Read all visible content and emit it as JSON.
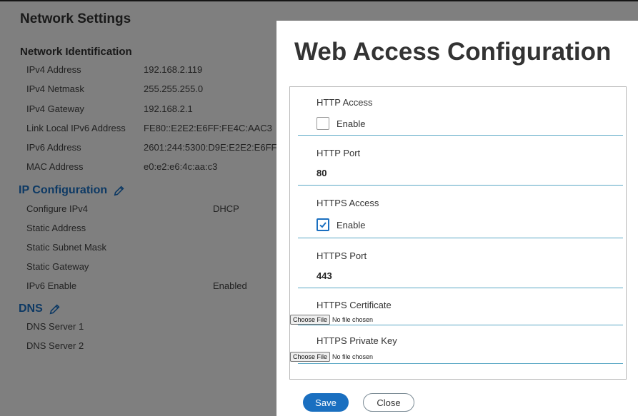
{
  "background": {
    "title": "Network Settings",
    "network_identification": {
      "heading": "Network Identification",
      "rows": [
        {
          "label": "IPv4 Address",
          "value": "192.168.2.119"
        },
        {
          "label": "IPv4 Netmask",
          "value": "255.255.255.0"
        },
        {
          "label": "IPv4 Gateway",
          "value": "192.168.2.1"
        },
        {
          "label": "Link Local IPv6 Address",
          "value": "FE80::E2E2:E6FF:FE4C:AAC3"
        },
        {
          "label": "IPv6 Address",
          "value": "2601:244:5300:D9E:E2E2:E6FF"
        },
        {
          "label": "MAC Address",
          "value": "e0:e2:e6:4c:aa:c3"
        }
      ]
    },
    "ip_configuration": {
      "heading": "IP Configuration",
      "rows": [
        {
          "label": "Configure IPv4",
          "value": "DHCP"
        },
        {
          "label": "Static Address",
          "value": ""
        },
        {
          "label": "Static Subnet Mask",
          "value": ""
        },
        {
          "label": "Static Gateway",
          "value": ""
        },
        {
          "label": "IPv6 Enable",
          "value": "Enabled"
        }
      ]
    },
    "dns": {
      "heading": "DNS",
      "rows": [
        {
          "label": "DNS Server 1",
          "value": ""
        },
        {
          "label": "DNS Server 2",
          "value": ""
        }
      ]
    }
  },
  "modal": {
    "title": "Web Access Configuration",
    "http_access": {
      "label": "HTTP Access",
      "checkbox_label": "Enable",
      "checked": false
    },
    "http_port": {
      "label": "HTTP Port",
      "value": "80"
    },
    "https_access": {
      "label": "HTTPS Access",
      "checkbox_label": "Enable",
      "checked": true
    },
    "https_port": {
      "label": "HTTPS Port",
      "value": "443"
    },
    "https_certificate": {
      "label": "HTTPS Certificate",
      "button": "Choose File",
      "status": "No file chosen"
    },
    "https_private_key": {
      "label": "HTTPS Private Key",
      "button": "Choose File",
      "status": "No file chosen"
    },
    "save_label": "Save",
    "close_label": "Close"
  },
  "colors": {
    "accent": "#1a6fc0",
    "divider": "#5aa7c5",
    "overlay": "rgba(0,0,0,0.5)"
  }
}
